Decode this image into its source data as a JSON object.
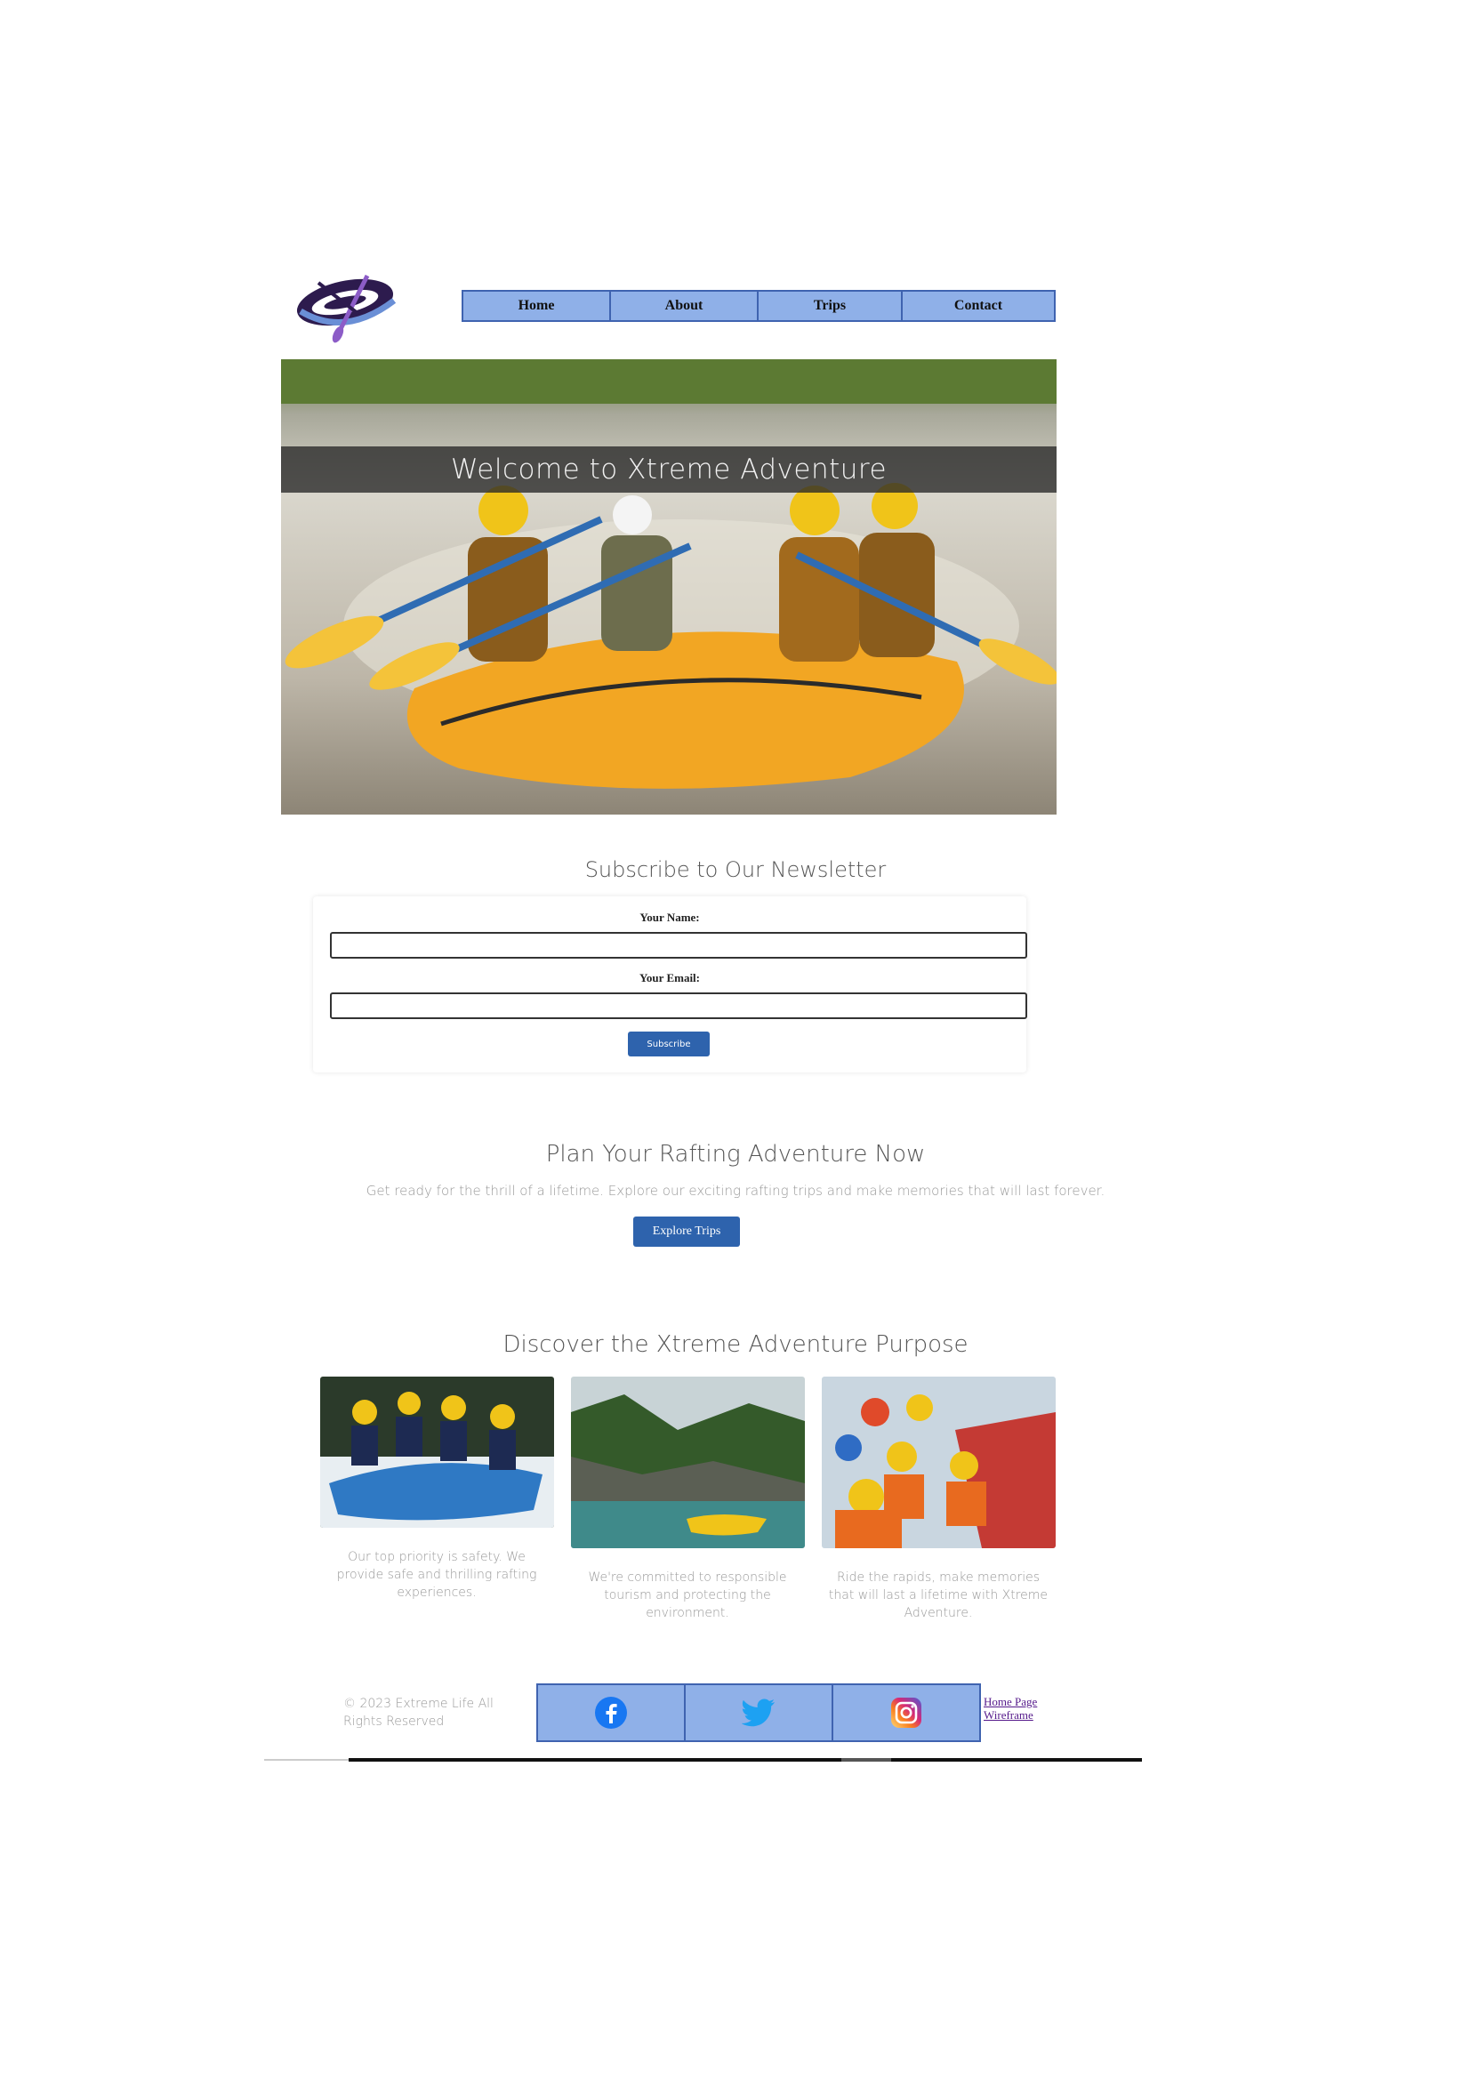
{
  "logo": {
    "icon": "raft-paddle-logo"
  },
  "nav": {
    "items": [
      {
        "label": "Home"
      },
      {
        "label": "About"
      },
      {
        "label": "Trips"
      },
      {
        "label": "Contact"
      }
    ]
  },
  "hero": {
    "title": "Welcome to Xtreme Adventure",
    "image": "rafting-crew-yellow-raft-photo"
  },
  "newsletter": {
    "title": "Subscribe to Our Newsletter",
    "name_label": "Your Name:",
    "email_label": "Your Email:",
    "name_value": "",
    "email_value": "",
    "button": "Subscribe"
  },
  "plan": {
    "title": "Plan Your Rafting Adventure Now",
    "text": "Get ready for the thrill of a lifetime. Explore our exciting rafting trips and make memories that will last forever.",
    "button": "Explore Trips"
  },
  "purpose": {
    "title": "Discover the Xtreme Adventure Purpose",
    "cards": [
      {
        "image": "rafting-team-photo",
        "text": "Our top priority is safety. We provide safe and thrilling rafting experiences."
      },
      {
        "image": "river-landscape-photo",
        "text": "We're committed to responsible tourism and protecting the environment."
      },
      {
        "image": "happy-rafters-photo",
        "text": "Ride the rapids, make memories that will last a lifetime with Xtreme Adventure."
      }
    ]
  },
  "footer": {
    "copyright": "© 2023 Extreme Life All Rights Reserved",
    "social": [
      {
        "icon": "facebook-icon",
        "color": "#1877f2"
      },
      {
        "icon": "twitter-icon",
        "color": "#1da1f2"
      },
      {
        "icon": "instagram-icon",
        "color": "#e1306c"
      }
    ],
    "links": [
      "Home Page",
      "Wireframe"
    ]
  }
}
